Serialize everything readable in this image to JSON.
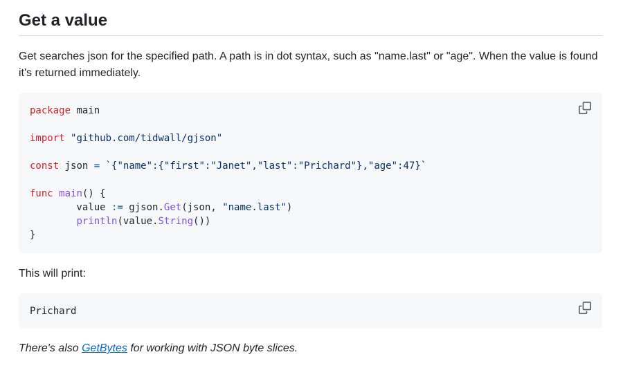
{
  "section": {
    "title": "Get a value",
    "intro": "Get searches json for the specified path. A path is in dot syntax, such as \"name.last\" or \"age\". When the value is found it's returned immediately."
  },
  "code_example": {
    "kw_package": "package",
    "pkg_name": " main",
    "kw_import": "import",
    "import_path": "\"github.com/tidwall/gjson\"",
    "kw_const": "const",
    "const_decl": " json ",
    "const_op": "=",
    "const_value": " `{\"name\":{\"first\":\"Janet\",\"last\":\"Prichard\"},\"age\":47}`",
    "kw_func": "func",
    "func_name": "main",
    "func_sig": "() {",
    "line_value_var": "        value ",
    "line_value_op": ":=",
    "line_value_pkg": " gjson.",
    "line_value_fn": "Get",
    "line_value_args_a": "(json, ",
    "line_value_args_str": "\"name.last\"",
    "line_value_args_b": ")",
    "line_print_indent": "        ",
    "line_print_fn": "println",
    "line_print_mid": "(value.",
    "line_print_method": "String",
    "line_print_end": "())",
    "closing_brace": "}",
    "copy_icon": "copy-icon"
  },
  "output_intro": "This will print:",
  "output_example": {
    "text": "Prichard",
    "copy_icon": "copy-icon"
  },
  "footer_note": {
    "prefix": "There's also ",
    "link": "GetBytes",
    "suffix": " for working with JSON byte slices."
  },
  "colors": {
    "keyword": "#cf222e",
    "string": "#0a3069",
    "function": "#8250df",
    "operator": "#0550ae",
    "link": "#0969da",
    "code_bg": "#f6f8fa"
  }
}
